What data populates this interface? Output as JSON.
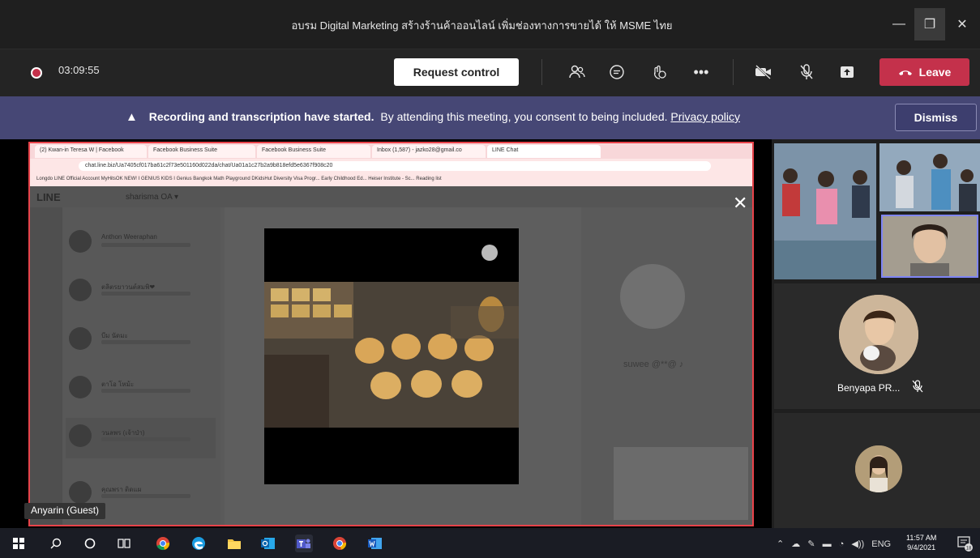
{
  "window": {
    "title": "อบรม Digital Marketing สร้างร้านค้าออนไลน์ เพิ่มช่องทางการขายได้ ให้ MSME ไทย",
    "minimize_glyph": "—",
    "maximize_glyph": "❐",
    "close_glyph": "✕"
  },
  "toolbar": {
    "timer": "03:09:55",
    "request_control_label": "Request control",
    "leave_label": "Leave",
    "icons": [
      "participants-icon",
      "chat-icon",
      "reactions-icon",
      "more-icon",
      "camera-off-icon",
      "mic-off-icon",
      "share-icon"
    ],
    "more_glyph": "•••"
  },
  "banner": {
    "bold_text": "Recording and transcription have started.",
    "body_text": "By attending this meeting, you consent to being included.",
    "link_text": "Privacy policy",
    "dismiss_label": "Dismiss",
    "warn_glyph": "▲"
  },
  "shared_screen": {
    "browser_tabs": [
      "(2) Kwan-in Teresa W | Facebook",
      "Facebook Business Suite",
      "Facebook Business Suite",
      "Inbox (1,587) - jazko28@gmail.co",
      "LINE Chat"
    ],
    "url": "chat.line.biz/Ua7405cf017ba61c2f73e501160d022da/chat/Ua01a1c27b2a9b818efd5e6367f908c20",
    "bookmarks": "Longdo   LINE Official Account   MyHitsOK   NEW! I GENIUS KIDS   I Genius Bangkok   Math Playground   DKidsHut   Diversity Visa Progr...   Early Childhood Ed...   Heiser Institute - Sc...   Reading list",
    "line_logo": "LINE",
    "line_account": "sharisma OA ▾",
    "chat_list": [
      {
        "name": "Anthon Weeraphan"
      },
      {
        "name": "ตลิตรยาวนต์สมพิ❤"
      },
      {
        "name": "บีม นัดมะ"
      },
      {
        "name": "ตาโอ โหม้ะ"
      },
      {
        "name": "วนลพร (เจ้าป่า)"
      },
      {
        "name": "คุณพรา ติดแผ"
      }
    ],
    "profile_name": "suwee @**@ ♪",
    "close_glyph": "✕",
    "presenter": "Anyarin (Guest)"
  },
  "participants": {
    "benyapa_name": "Benyapa PR...",
    "mute_glyph": "🎙̸"
  },
  "taskbar": {
    "language": "ENG",
    "time": "11:57 AM",
    "date": "9/4/2021",
    "notifications": "18"
  },
  "colors": {
    "leave_red": "#c4314b",
    "banner_purple": "#464775",
    "self_tile_border": "#7f85f5",
    "screen_share_border": "#e8434a"
  }
}
